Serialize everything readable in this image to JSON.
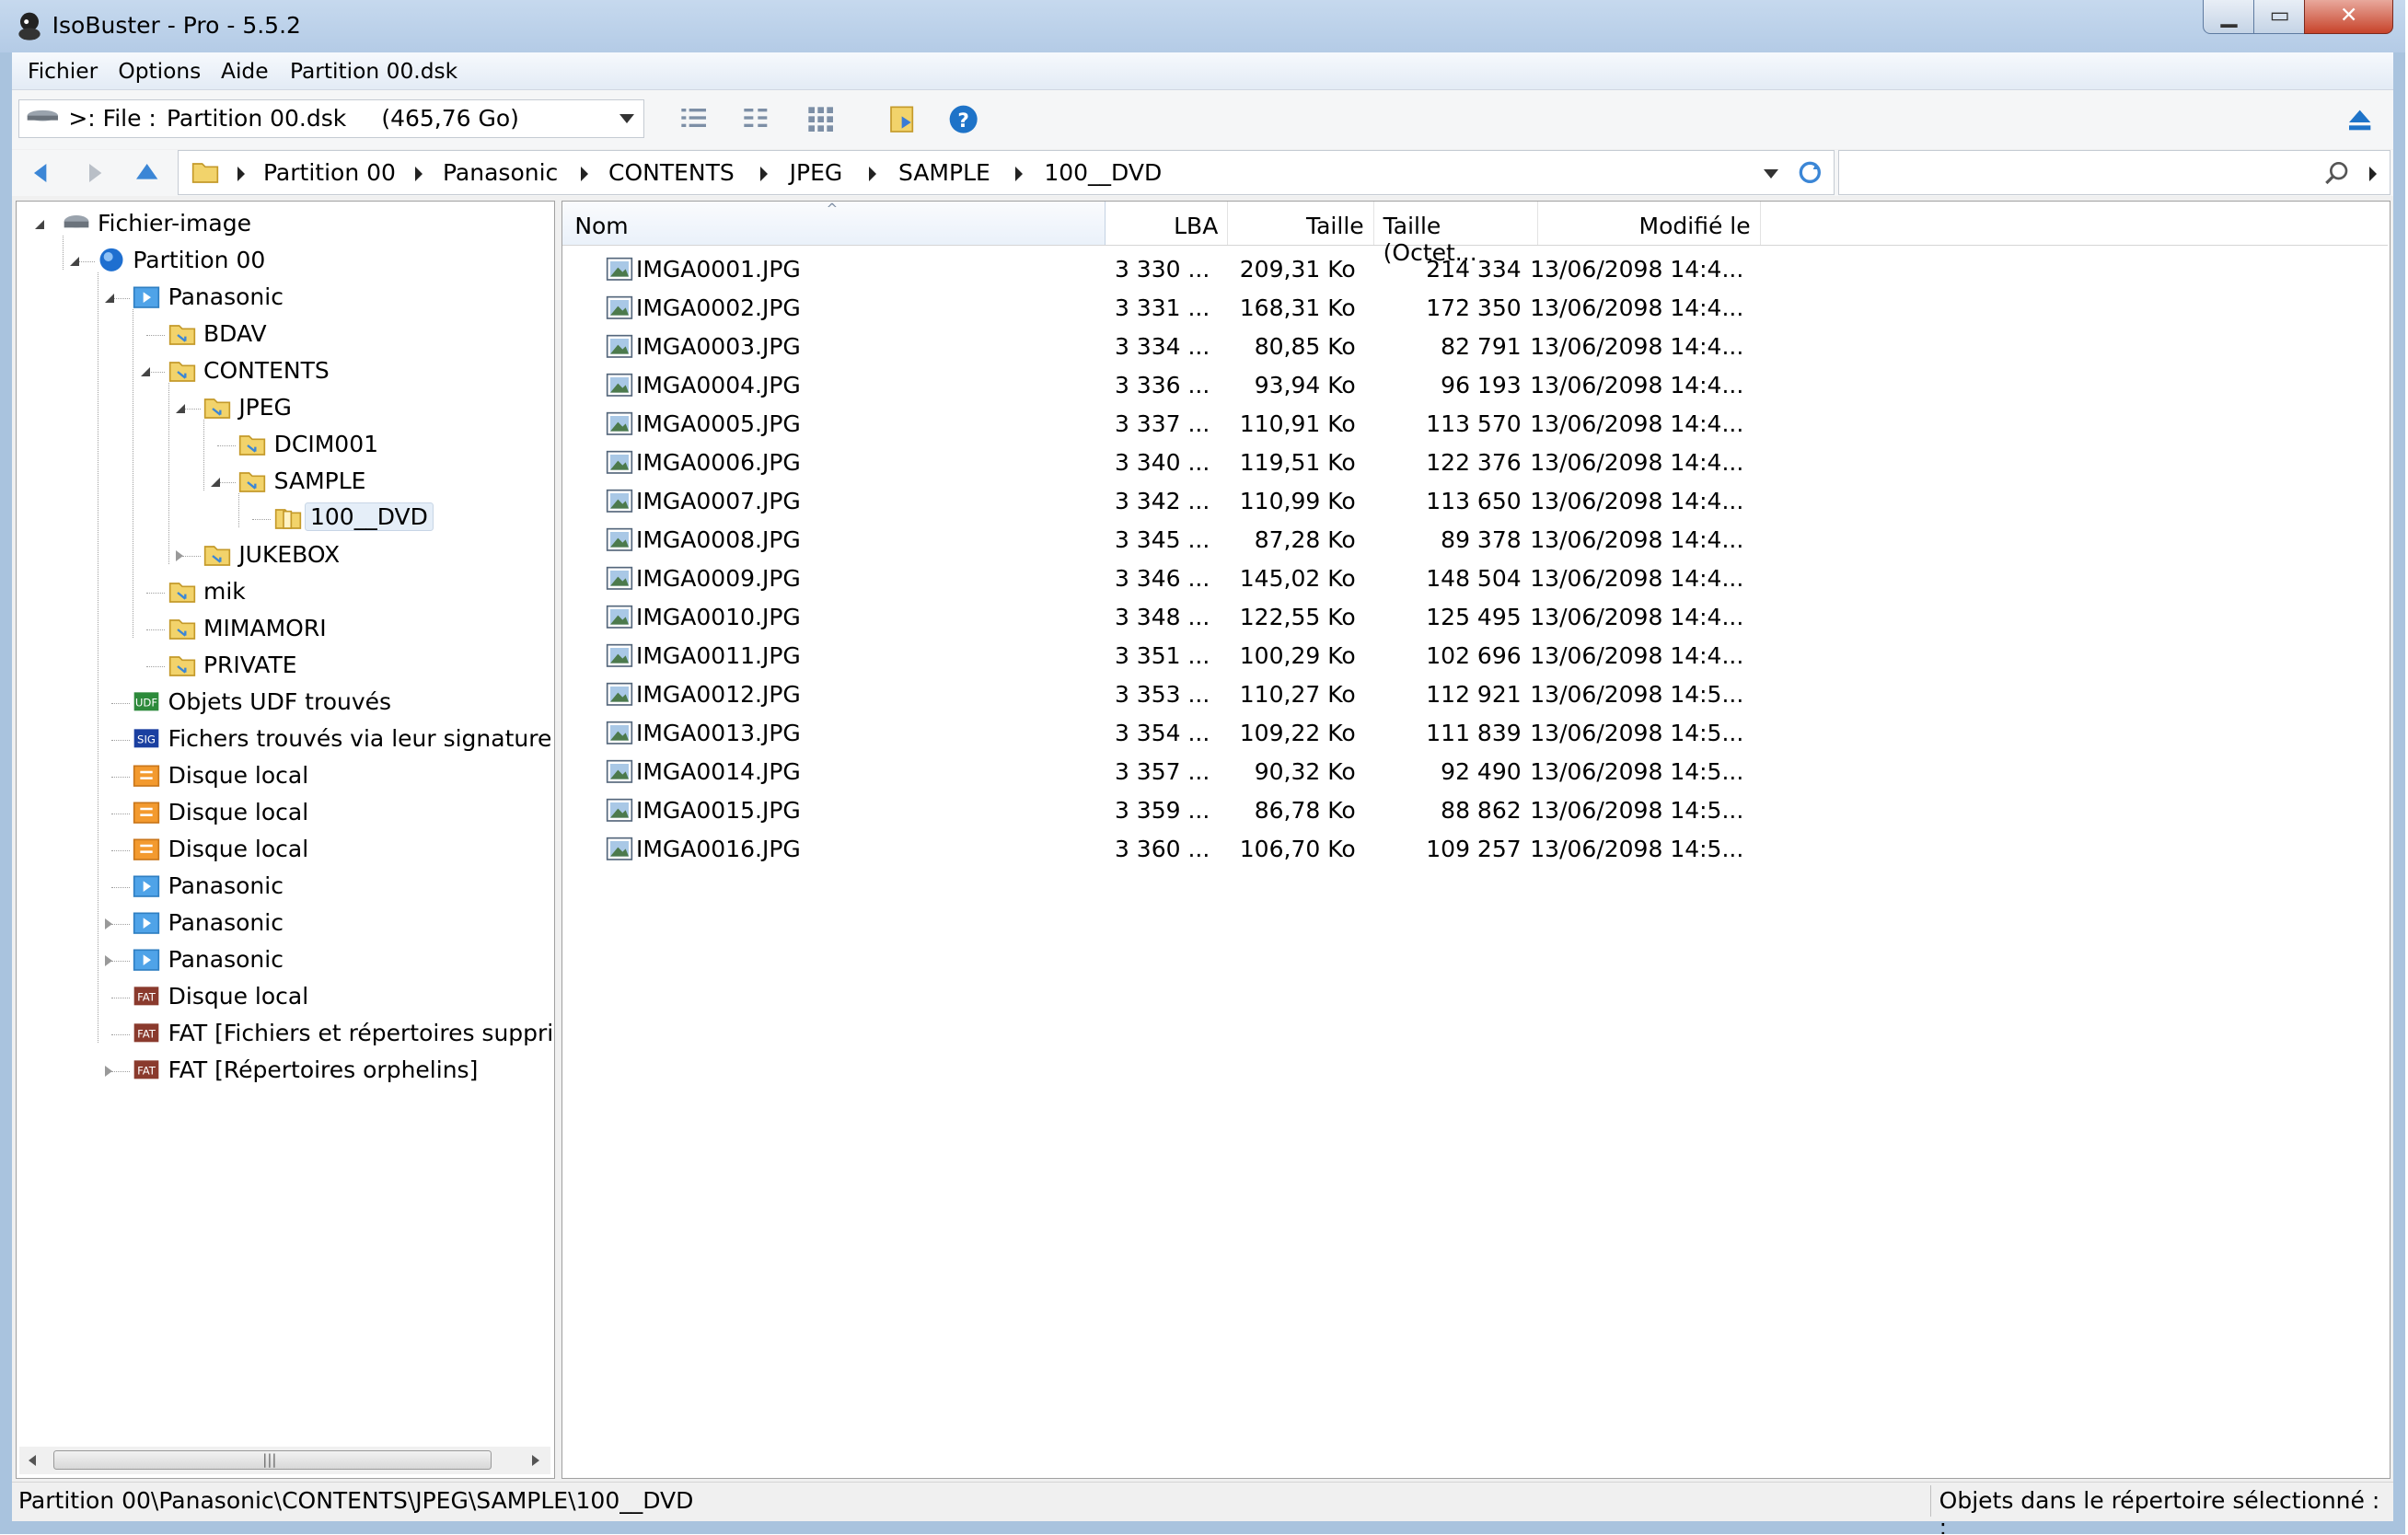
{
  "window": {
    "title": "IsoBuster - Pro - 5.5.2"
  },
  "menu": {
    "items": [
      "Fichier",
      "Options",
      "Aide",
      "Partition 00.dsk"
    ]
  },
  "toolbar": {
    "source_label": ">: File :",
    "source_name": "Partition 00.dsk",
    "source_size": "(465,76 Go)"
  },
  "breadcrumb": [
    "Partition 00",
    "Panasonic",
    "CONTENTS",
    "JPEG",
    "SAMPLE",
    "100__DVD"
  ],
  "tree": {
    "nodes": [
      {
        "label": "Fichier-image",
        "icon": "drive-icon"
      },
      {
        "label": "Partition 00",
        "icon": "partition-icon"
      },
      {
        "label": "Panasonic",
        "icon": "video-folder-icon"
      },
      {
        "label": "BDAV",
        "icon": "folder-icon"
      },
      {
        "label": "CONTENTS",
        "icon": "folder-icon"
      },
      {
        "label": "JPEG",
        "icon": "folder-icon"
      },
      {
        "label": "DCIM001",
        "icon": "folder-icon"
      },
      {
        "label": "SAMPLE",
        "icon": "folder-icon"
      },
      {
        "label": "100__DVD",
        "icon": "folder-open-icon",
        "selected": true
      },
      {
        "label": "JUKEBOX",
        "icon": "folder-icon"
      },
      {
        "label": "mik",
        "icon": "folder-icon"
      },
      {
        "label": "MIMAMORI",
        "icon": "folder-icon"
      },
      {
        "label": "PRIVATE",
        "icon": "folder-icon"
      },
      {
        "label": "Objets UDF trouvés",
        "icon": "udf-icon"
      },
      {
        "label": "Fichers trouvés via leur signature",
        "icon": "sig-icon"
      },
      {
        "label": "Disque local",
        "icon": "disk-icon"
      },
      {
        "label": "Disque local",
        "icon": "disk-icon"
      },
      {
        "label": "Disque local",
        "icon": "disk-icon"
      },
      {
        "label": "Panasonic",
        "icon": "video-folder-icon"
      },
      {
        "label": "Panasonic",
        "icon": "video-folder-icon"
      },
      {
        "label": "Panasonic",
        "icon": "video-folder-icon"
      },
      {
        "label": "Disque local",
        "icon": "fat-icon"
      },
      {
        "label": "FAT [Fichiers et répertoires supprim",
        "icon": "fat-icon"
      },
      {
        "label": "FAT [Répertoires orphelins]",
        "icon": "fat-icon"
      }
    ]
  },
  "list": {
    "columns": [
      "Nom",
      "LBA",
      "Taille",
      "Taille (Octet...",
      "Modifié le"
    ],
    "rows": [
      [
        "IMGA0001.JPG",
        "3 330 ...",
        "209,31 Ko",
        "214 334",
        "13/06/2098 14:4..."
      ],
      [
        "IMGA0002.JPG",
        "3 331 ...",
        "168,31 Ko",
        "172 350",
        "13/06/2098 14:4..."
      ],
      [
        "IMGA0003.JPG",
        "3 334 ...",
        "80,85 Ko",
        "82 791",
        "13/06/2098 14:4..."
      ],
      [
        "IMGA0004.JPG",
        "3 336 ...",
        "93,94 Ko",
        "96 193",
        "13/06/2098 14:4..."
      ],
      [
        "IMGA0005.JPG",
        "3 337 ...",
        "110,91 Ko",
        "113 570",
        "13/06/2098 14:4..."
      ],
      [
        "IMGA0006.JPG",
        "3 340 ...",
        "119,51 Ko",
        "122 376",
        "13/06/2098 14:4..."
      ],
      [
        "IMGA0007.JPG",
        "3 342 ...",
        "110,99 Ko",
        "113 650",
        "13/06/2098 14:4..."
      ],
      [
        "IMGA0008.JPG",
        "3 345 ...",
        "87,28 Ko",
        "89 378",
        "13/06/2098 14:4..."
      ],
      [
        "IMGA0009.JPG",
        "3 346 ...",
        "145,02 Ko",
        "148 504",
        "13/06/2098 14:4..."
      ],
      [
        "IMGA0010.JPG",
        "3 348 ...",
        "122,55 Ko",
        "125 495",
        "13/06/2098 14:4..."
      ],
      [
        "IMGA0011.JPG",
        "3 351 ...",
        "100,29 Ko",
        "102 696",
        "13/06/2098 14:4..."
      ],
      [
        "IMGA0012.JPG",
        "3 353 ...",
        "110,27 Ko",
        "112 921",
        "13/06/2098 14:5..."
      ],
      [
        "IMGA0013.JPG",
        "3 354 ...",
        "109,22 Ko",
        "111 839",
        "13/06/2098 14:5..."
      ],
      [
        "IMGA0014.JPG",
        "3 357 ...",
        "90,32 Ko",
        "92 490",
        "13/06/2098 14:5..."
      ],
      [
        "IMGA0015.JPG",
        "3 359 ...",
        "86,78 Ko",
        "88 862",
        "13/06/2098 14:5..."
      ],
      [
        "IMGA0016.JPG",
        "3 360 ...",
        "106,70 Ko",
        "109 257",
        "13/06/2098 14:5..."
      ]
    ]
  },
  "status": {
    "path": "Partition 00\\Panasonic\\CONTENTS\\JPEG\\SAMPLE\\100__DVD",
    "right": "Objets dans le répertoire sélectionné : :"
  },
  "colors": {
    "accent": "#1e73c8",
    "selection": "#e5eef8",
    "folder": "#e8c15a"
  }
}
